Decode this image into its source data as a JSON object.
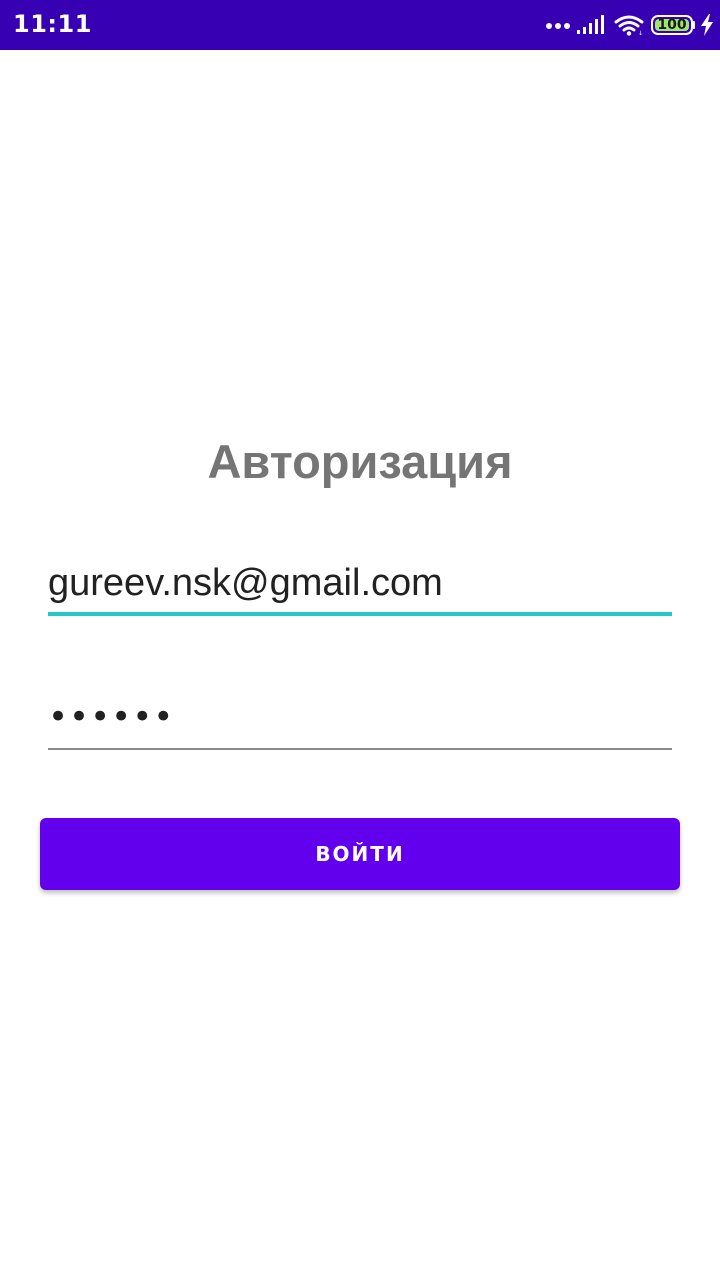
{
  "status_bar": {
    "time": "11:11",
    "battery_level": "100",
    "background_color": "#3700b3",
    "icons": [
      "more-dots-icon",
      "signal-icon",
      "wifi-icon",
      "battery-icon",
      "charging-icon"
    ]
  },
  "screen": {
    "title": "Авторизация"
  },
  "form": {
    "email_value": "gureev.nsk@gmail.com",
    "password_masked": "••••••",
    "submit_label": "войти"
  },
  "colors": {
    "accent_underline": "#26c6c6",
    "button_background": "#6200ee",
    "title_color": "#757575"
  }
}
